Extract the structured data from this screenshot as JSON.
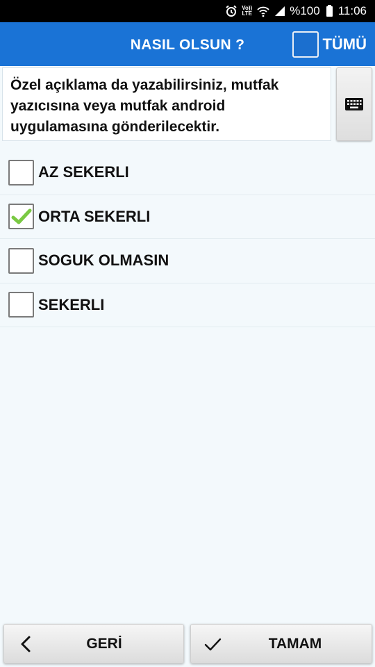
{
  "status_bar": {
    "volte_top": "Vo))",
    "volte_bottom": "LTE",
    "battery": "%100",
    "time": "11:06"
  },
  "app_bar": {
    "title": "NASIL OLSUN ?",
    "select_all_label": "TÜMÜ",
    "select_all_checked": false
  },
  "note": {
    "text": "Özel açıklama da yazabilirsiniz, mutfak yazıcısına veya mutfak android uygulamasına gönderilecektir."
  },
  "options": [
    {
      "label": "AZ SEKERLI",
      "checked": false
    },
    {
      "label": "ORTA SEKERLI",
      "checked": true
    },
    {
      "label": "SOGUK OLMASIN",
      "checked": false
    },
    {
      "label": "SEKERLI",
      "checked": false
    }
  ],
  "footer": {
    "back_label": "GERİ",
    "ok_label": "TAMAM"
  },
  "colors": {
    "app_bar": "#1a73d6",
    "check_mark": "#7ac943",
    "background": "#f3f9fc"
  }
}
